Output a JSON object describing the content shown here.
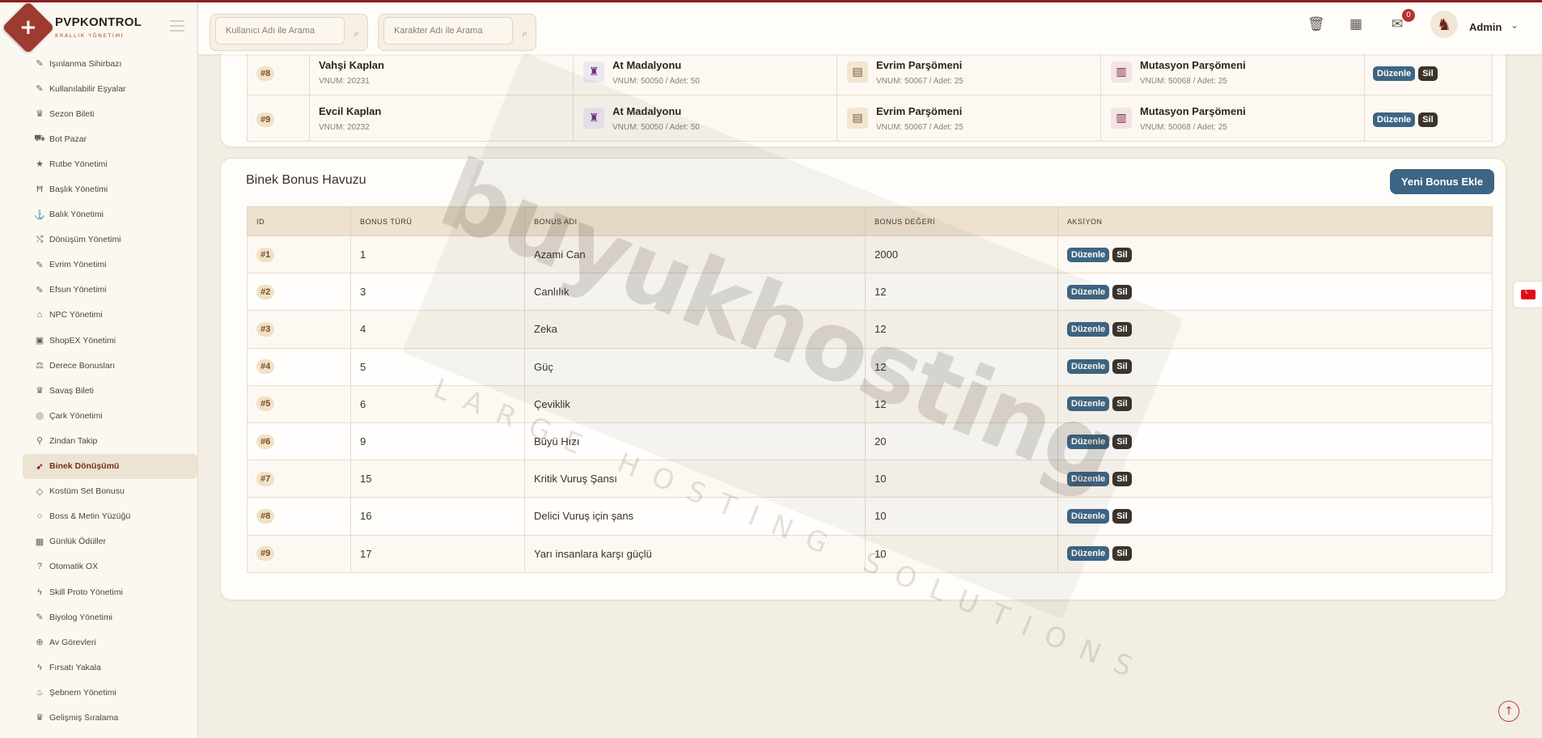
{
  "brand": {
    "name": "PVPKONTROL",
    "subtitle": "KRALLIK YÖNETİMİ",
    "logo_glyph": "+"
  },
  "header": {
    "search_user_placeholder": "Kullanıcı Adı ile Arama",
    "search_char_placeholder": "Karakter Adı ile Arama",
    "notification_count": "0",
    "admin_name": "Admin"
  },
  "sidebar": {
    "items": [
      {
        "label": "Işınlanma Sihirbazı",
        "icon": "wand-icon"
      },
      {
        "label": "Kullanılabilir Eşyalar",
        "icon": "wand-icon"
      },
      {
        "label": "Sezon Bileti",
        "icon": "trophy-icon"
      },
      {
        "label": "Bot Pazar",
        "icon": "cart-icon"
      },
      {
        "label": "Rutbe Yönetimi",
        "icon": "star-icon"
      },
      {
        "label": "Başlık Yönetimi",
        "icon": "heading-icon"
      },
      {
        "label": "Balık Yönetimi",
        "icon": "anchor-icon"
      },
      {
        "label": "Dönüşüm Yönetimi",
        "icon": "shuffle-icon"
      },
      {
        "label": "Evrim Yönetimi",
        "icon": "wand-icon"
      },
      {
        "label": "Efsun Yönetimi",
        "icon": "wand-icon"
      },
      {
        "label": "NPC Yönetimi",
        "icon": "bank-icon"
      },
      {
        "label": "ShopEX Yönetimi",
        "icon": "shop-icon"
      },
      {
        "label": "Derece Bonusları",
        "icon": "scale-icon"
      },
      {
        "label": "Savaş Bileti",
        "icon": "trophy-icon"
      },
      {
        "label": "Çark Yönetimi",
        "icon": "wheel-icon"
      },
      {
        "label": "Zindan Takip",
        "icon": "pin-icon"
      },
      {
        "label": "Binek Dönüşümü",
        "icon": "horse-icon",
        "active": true
      },
      {
        "label": "Kostüm Set Bonusu",
        "icon": "gem-icon"
      },
      {
        "label": "Boss & Metin Yüzüğü",
        "icon": "ring-icon"
      },
      {
        "label": "Günlük Ödüller",
        "icon": "calendar-icon"
      },
      {
        "label": "Otomatik OX",
        "icon": "question-icon"
      },
      {
        "label": "Skill Proto Yönetimi",
        "icon": "bolt-icon"
      },
      {
        "label": "Biyolog Yönetimi",
        "icon": "wand-icon"
      },
      {
        "label": "Av Görevleri",
        "icon": "crosshair-icon"
      },
      {
        "label": "Fırsatı Yakala",
        "icon": "bolt-icon"
      },
      {
        "label": "Şebnem Yönetimi",
        "icon": "flame-icon"
      },
      {
        "label": "Gelişmiş Sıralama",
        "icon": "trophy-icon"
      }
    ]
  },
  "mount_table": {
    "rows": [
      {
        "id": "#8",
        "name": "Vahşi Kaplan",
        "vnum": "VNUM: 20231",
        "item1": {
          "name": "At Madalyonu",
          "sub": "VNUM: 50050 / Adet: 50"
        },
        "item2": {
          "name": "Evrim Parşömeni",
          "sub": "VNUM: 50067 / Adet: 25"
        },
        "item3": {
          "name": "Mutasyon Parşömeni",
          "sub": "VNUM: 50068 / Adet: 25"
        }
      },
      {
        "id": "#9",
        "name": "Evcil Kaplan",
        "vnum": "VNUM: 20232",
        "item1": {
          "name": "At Madalyonu",
          "sub": "VNUM: 50050 / Adet: 50"
        },
        "item2": {
          "name": "Evrim Parşömeni",
          "sub": "VNUM: 50067 / Adet: 25"
        },
        "item3": {
          "name": "Mutasyon Parşömeni",
          "sub": "VNUM: 50068 / Adet: 25"
        }
      }
    ]
  },
  "bonus_pool": {
    "title": "Binek Bonus Havuzu",
    "new_button": "Yeni Bonus Ekle",
    "columns": [
      "ID",
      "BONUS TÜRÜ",
      "BONUS ADI",
      "BONUS DEĞERİ",
      "AKSİYON"
    ],
    "rows": [
      {
        "id": "#1",
        "type": "1",
        "name": "Azami Can",
        "value": "2000"
      },
      {
        "id": "#2",
        "type": "3",
        "name": "Canlılık",
        "value": "12"
      },
      {
        "id": "#3",
        "type": "4",
        "name": "Zeka",
        "value": "12"
      },
      {
        "id": "#4",
        "type": "5",
        "name": "Güç",
        "value": "12"
      },
      {
        "id": "#5",
        "type": "6",
        "name": "Çeviklik",
        "value": "12"
      },
      {
        "id": "#6",
        "type": "9",
        "name": "Büyü Hızı",
        "value": "20"
      },
      {
        "id": "#7",
        "type": "15",
        "name": "Kritik Vuruş Şansı",
        "value": "10"
      },
      {
        "id": "#8",
        "type": "16",
        "name": "Delici Vuruş için şans",
        "value": "10"
      },
      {
        "id": "#9",
        "type": "17",
        "name": "Yarı insanlara karşı güçlü",
        "value": "10"
      }
    ]
  },
  "actions": {
    "edit": "Düzenle",
    "delete": "Sil"
  },
  "watermark": {
    "main": "buyukhosting",
    "sub": "LARGE HOSTING SOLUTIONS"
  },
  "colors": {
    "accent": "#3d6584",
    "brand": "#9e3b31",
    "dark_button": "#3a342d",
    "badge": "#b8332a"
  }
}
